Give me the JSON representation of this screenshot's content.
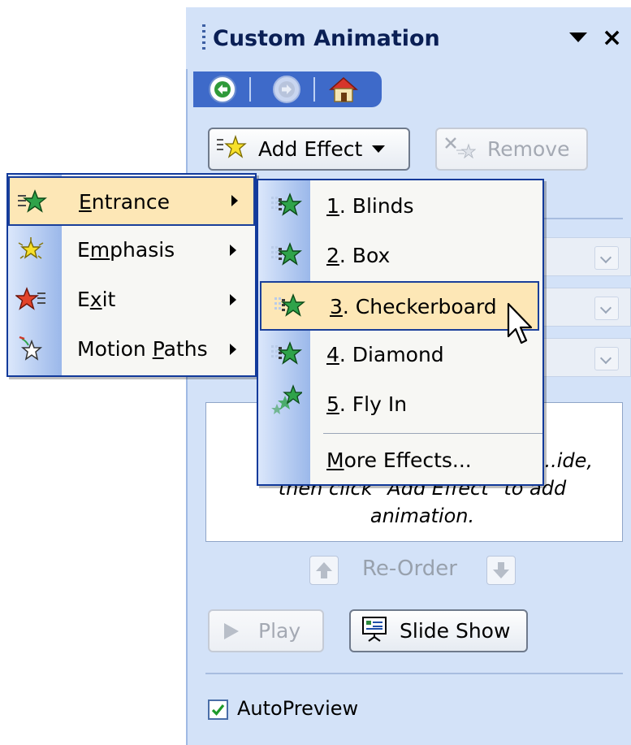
{
  "pane": {
    "title": "Custom Animation",
    "nav": {
      "back_icon": "back-arrow-icon",
      "forward_icon": "forward-arrow-icon",
      "home_icon": "home-icon"
    },
    "add_effect_label": "Add Effect",
    "remove_label": "Remove",
    "hint_line1": "...ide,",
    "hint_line2": "then click \"Add Effect\" to add",
    "hint_line3": "animation.",
    "reorder_label": "Re-Order",
    "play_label": "Play",
    "slideshow_label": "Slide Show",
    "autopreview_label": "AutoPreview",
    "autopreview_checked": true
  },
  "effect_menu": {
    "items": [
      {
        "pre": "",
        "key": "E",
        "post": "ntrance",
        "icon": "entrance-star-icon",
        "highlighted": true
      },
      {
        "pre": "E",
        "key": "m",
        "post": "phasis",
        "icon": "emphasis-star-icon"
      },
      {
        "pre": "E",
        "key": "x",
        "post": "it",
        "icon": "exit-star-icon"
      },
      {
        "pre": "Motion ",
        "key": "P",
        "post": "aths",
        "icon": "motion-path-star-icon"
      }
    ]
  },
  "entrance_menu": {
    "items": [
      {
        "key": "1",
        "post": ". Blinds"
      },
      {
        "key": "2",
        "post": ". Box"
      },
      {
        "key": "3",
        "post": ". Checkerboard",
        "highlighted": true
      },
      {
        "key": "4",
        "post": ". Diamond"
      },
      {
        "key": "5",
        "post": ". Fly In"
      }
    ],
    "more_key": "M",
    "more_post": "ore Effects..."
  },
  "colors": {
    "pane_bg": "#d3e2f8",
    "nav_strip": "#3e6ac9",
    "highlight": "#fde7b6",
    "menu_border": "#123a9b"
  }
}
